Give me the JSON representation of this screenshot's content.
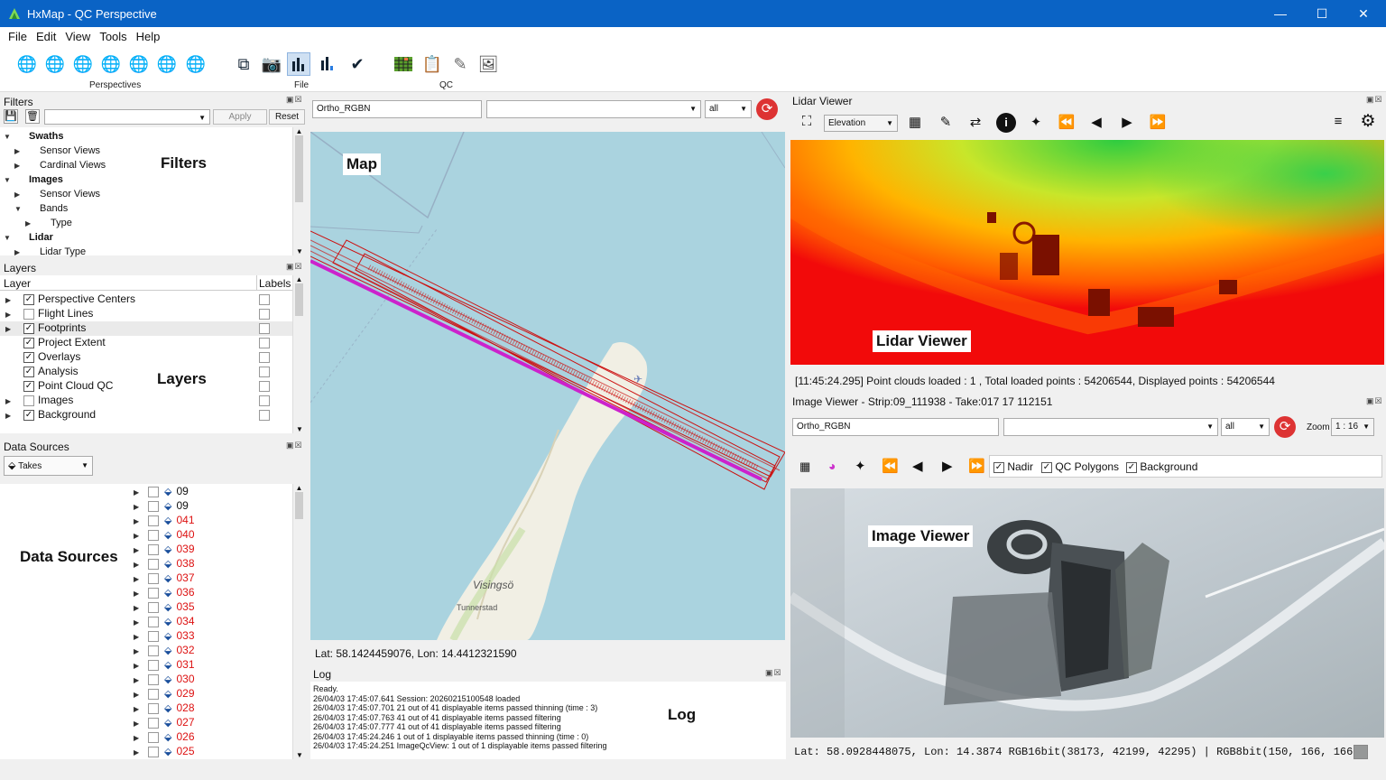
{
  "window": {
    "title": "HxMap - QC Perspective"
  },
  "menu": [
    "File",
    "Edit",
    "View",
    "Tools",
    "Help"
  ],
  "toolbar": {
    "groups": [
      "Perspectives",
      "File",
      "QC"
    ],
    "perspective_icons": [
      "globe-filter-icon",
      "globe-edit-icon",
      "globe-4-icon",
      "globe-settings-icon",
      "globe-grid-icon",
      "globe-3d-icon",
      "globe-play-icon"
    ],
    "file_icons": [
      "export-icon",
      "camera-save-icon",
      "bar-chart-icon",
      "bar-chart-add-icon",
      "checkmark-shield-icon"
    ],
    "qc_icons": [
      "grid-color-icon",
      "report-icon",
      "pencil-icon",
      "image-frame-icon"
    ]
  },
  "filters": {
    "title": "Filters",
    "apply": "Apply",
    "reset": "Reset",
    "callout": "Filters",
    "tree": [
      {
        "label": "Swaths",
        "bold": true,
        "indent": 0,
        "exp": "open"
      },
      {
        "label": "Sensor Views",
        "indent": 1,
        "exp": "closed"
      },
      {
        "label": "Cardinal Views",
        "indent": 1,
        "exp": "closed"
      },
      {
        "label": "Images",
        "bold": true,
        "indent": 0,
        "exp": "open"
      },
      {
        "label": "Sensor Views",
        "indent": 1,
        "exp": "closed"
      },
      {
        "label": "Bands",
        "indent": 1,
        "exp": "open"
      },
      {
        "label": "Type",
        "indent": 2,
        "exp": "closed"
      },
      {
        "label": "Lidar",
        "bold": true,
        "indent": 0,
        "exp": "open"
      },
      {
        "label": "Lidar Type",
        "indent": 1,
        "exp": "closed"
      }
    ]
  },
  "layers": {
    "title": "Layers",
    "col_layer": "Layer",
    "col_labels": "Labels",
    "callout": "Layers",
    "rows": [
      {
        "label": "Perspective Centers",
        "checked": true,
        "exp": true
      },
      {
        "label": "Flight Lines",
        "checked": false,
        "exp": true
      },
      {
        "label": "Footprints",
        "checked": true,
        "exp": true
      },
      {
        "label": "Project Extent",
        "checked": true,
        "exp": false
      },
      {
        "label": "Overlays",
        "checked": true,
        "exp": false
      },
      {
        "label": "Analysis",
        "checked": true,
        "exp": false
      },
      {
        "label": "Point Cloud QC",
        "checked": true,
        "exp": false
      },
      {
        "label": "Images",
        "checked": false,
        "exp": true
      },
      {
        "label": "Background",
        "checked": true,
        "exp": true
      }
    ]
  },
  "datasources": {
    "title": "Data Sources",
    "combo": "Takes",
    "callout": "Data Sources",
    "rows": [
      {
        "n": "09",
        "red": false
      },
      {
        "n": "09",
        "red": false
      },
      {
        "n": "041",
        "red": true
      },
      {
        "n": "040",
        "red": true
      },
      {
        "n": "039",
        "red": true
      },
      {
        "n": "038",
        "red": true
      },
      {
        "n": "037",
        "red": true
      },
      {
        "n": "036",
        "red": true
      },
      {
        "n": "035",
        "red": true
      },
      {
        "n": "034",
        "red": true
      },
      {
        "n": "033",
        "red": true
      },
      {
        "n": "032",
        "red": true
      },
      {
        "n": "031",
        "red": true
      },
      {
        "n": "030",
        "red": true
      },
      {
        "n": "029",
        "red": true
      },
      {
        "n": "028",
        "red": true
      },
      {
        "n": "027",
        "red": true
      },
      {
        "n": "026",
        "red": true
      },
      {
        "n": "025",
        "red": true
      }
    ]
  },
  "map": {
    "layer_field": "Ortho_RGBN",
    "filter_value": "all",
    "callout": "Map",
    "place1": "Visingsö",
    "place2": "Tunnerstad",
    "coords": "Lat: 58.1424459076, Lon: 14.4412321590"
  },
  "log": {
    "title": "Log",
    "callout": "Log",
    "lines": [
      "Ready.",
      "26/04/03 17:45:07.641 Session: 20260215100548 loaded",
      "26/04/03 17:45:07.701  21 out of 41 displayable items passed thinning (time : 3)",
      "26/04/03 17:45:07.763  41 out of 41 displayable items passed filtering",
      "26/04/03 17:45:07.777  41 out of 41 displayable items passed filtering",
      "26/04/03 17:45:24.246  1 out of 1 displayable items passed thinning (time : 0)",
      "26/04/03 17:45:24.251 ImageQcView:  1 out of 1 displayable items passed filtering"
    ]
  },
  "lidar": {
    "title": "Lidar Viewer",
    "mode": "Elevation",
    "callout": "Lidar Viewer",
    "status": "[11:45:24.295] Point clouds loaded : 1 , Total loaded points : 54206544, Displayed points : 54206544"
  },
  "image": {
    "title": "Image Viewer - Strip:09_111938 - Take:017 17 112151",
    "layer_field": "Ortho_RGBN",
    "filter_value": "all",
    "zoom_label": "Zoom",
    "zoom_value": "1 : 16",
    "nadir": "Nadir",
    "qc_polygons": "QC Polygons",
    "background": "Background",
    "callout": "Image Viewer",
    "status": "Lat: 58.0928448075, Lon: 14.3874 RGB16bit(38173, 42199, 42295) | RGB8bit(150, 166, 166)"
  },
  "colors": {
    "titlebar": "#0a63c5",
    "flightline": "#cc22cc",
    "footprint": "#cc1111",
    "water": "#aad3df",
    "land": "#f1efe4"
  }
}
